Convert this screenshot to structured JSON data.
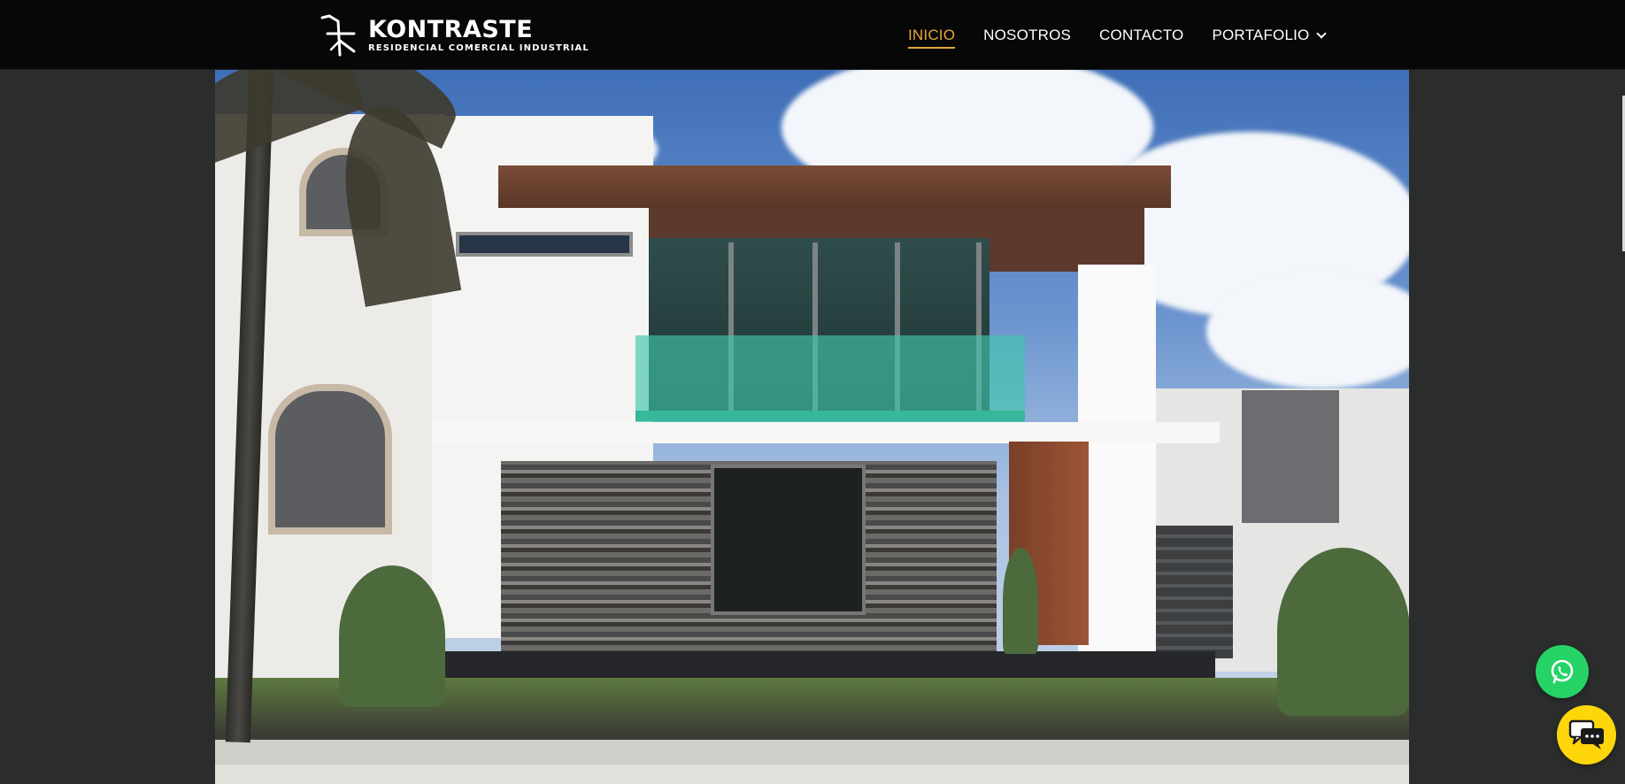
{
  "header": {
    "brand_name": "KONTRASTE",
    "brand_tagline": "RESIDENCIAL COMERCIAL INDUSTRIAL",
    "logo_icon": "kontraste-logo-icon"
  },
  "nav": {
    "items": [
      {
        "label": "INICIO",
        "active": true
      },
      {
        "label": "NOSOTROS",
        "active": false
      },
      {
        "label": "CONTACTO",
        "active": false
      },
      {
        "label": "PORTAFOLIO",
        "active": false,
        "has_dropdown": true
      }
    ],
    "active_color": "#e6a83a"
  },
  "hero": {
    "image_subject": "modern-house-facade-photo"
  },
  "floating": {
    "whatsapp_icon": "whatsapp-icon",
    "whatsapp_color": "#25d366",
    "chat_icon": "chat-bubbles-icon",
    "chat_color": "#ffd60a"
  }
}
